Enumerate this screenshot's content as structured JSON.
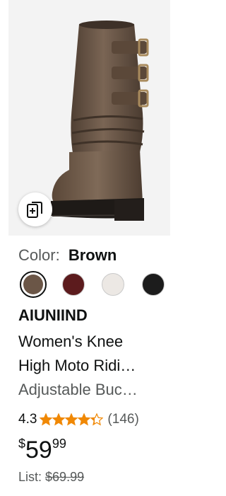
{
  "product": {
    "color_label": "Color:",
    "color_value": "Brown",
    "swatches": [
      {
        "name": "Brown",
        "color": "#6b5647",
        "selected": true
      },
      {
        "name": "Burgundy",
        "color": "#5c1b1d",
        "selected": false
      },
      {
        "name": "White",
        "color": "#ece8e4",
        "selected": false
      },
      {
        "name": "Black",
        "color": "#1c1c1c",
        "selected": false
      }
    ],
    "brand": "AIUNIIND",
    "title_line1": "Women's Knee",
    "title_line2": "High Moto Ridi…",
    "title_line3": "Adjustable Buc…",
    "rating": "4.3",
    "stars": 4.3,
    "review_count": "(146)",
    "price_symbol": "$",
    "price_whole": "59",
    "price_fraction": "99",
    "list_label": "List:",
    "list_price": "$69.99"
  },
  "colors": {
    "star": "#f08804",
    "secondary_text": "#565959",
    "image_bg": "#f3f3f3"
  },
  "icons": {
    "similar_items": "similar-items-icon",
    "star": "star-icon"
  }
}
